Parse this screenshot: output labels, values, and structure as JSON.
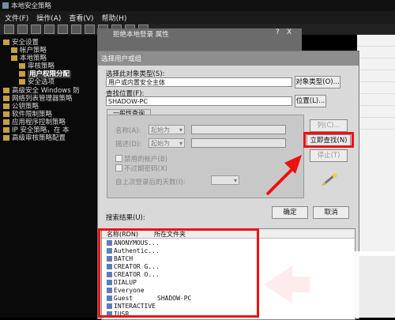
{
  "window": {
    "title": "本地安全策略"
  },
  "menu": {
    "file": "文件(F)",
    "action": "操作(A)",
    "view": "查看(V)",
    "help": "帮助(H)"
  },
  "tree": {
    "root": "安全设置",
    "items": [
      "帐户策略",
      "本地策略",
      "审核策略",
      "用户权限分配",
      "安全选项",
      "高级安全 Windows 防",
      "网络列表管理器策略",
      "公钥策略",
      "软件限制策略",
      "应用程序控制策略",
      "IP 安全策略，在 本",
      "高级审核策略配置"
    ]
  },
  "parent_dialog": {
    "title": "拒绝本地登录 属性",
    "help": "?",
    "close": "X"
  },
  "dialog": {
    "title": "选择用户或组",
    "object_type_label": "选择此对象类型(S):",
    "object_type_value": "用户或内置安全主体",
    "object_type_button": "对象类型(O)...",
    "location_label": "查找位置(F):",
    "location_value": "SHADOW-PC",
    "location_button": "位置(L)...",
    "tab_general": "一般性查询",
    "name_label": "名称(A):",
    "desc_label": "描述(D):",
    "starts_with": "起始为",
    "col_button": "列(C)...",
    "find_now_button": "立即查找(N)",
    "stop_button": "停止(T)",
    "disabled_accounts": "禁用的帐户(B)",
    "non_expiring": "不过期密码(X)",
    "days_since_logon": "自上次登录后的天数(I):",
    "ok_button": "确定",
    "cancel_button": "取消",
    "results_label": "搜索结果(U):",
    "col_name": "名称(RDN)",
    "col_folder": "所在文件夹",
    "results": [
      {
        "name": "ANONYMOUS...",
        "folder": ""
      },
      {
        "name": "Authentic...",
        "folder": ""
      },
      {
        "name": "BATCH",
        "folder": ""
      },
      {
        "name": "CREATOR G...",
        "folder": ""
      },
      {
        "name": "CREATOR O...",
        "folder": ""
      },
      {
        "name": "DIALUP",
        "folder": ""
      },
      {
        "name": "Everyone",
        "folder": ""
      },
      {
        "name": "Guest",
        "folder": "SHADOW-PC"
      },
      {
        "name": "INTERACTIVE",
        "folder": ""
      },
      {
        "name": "IUSR",
        "folder": ""
      }
    ]
  },
  "colors": {
    "highlight": "#e11111"
  }
}
